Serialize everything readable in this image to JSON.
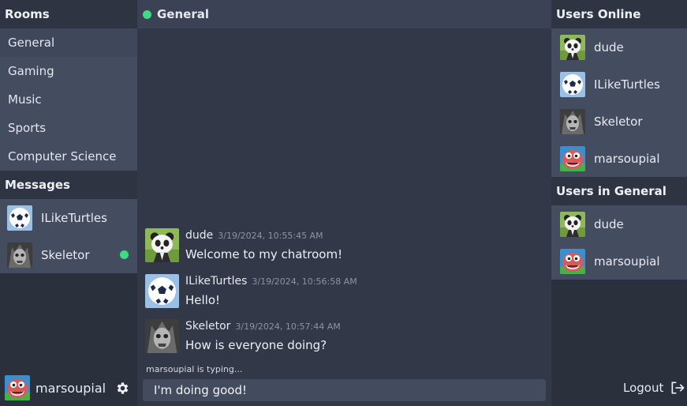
{
  "sidebar": {
    "rooms_heading": "Rooms",
    "rooms": [
      {
        "label": "General"
      },
      {
        "label": "Gaming"
      },
      {
        "label": "Music"
      },
      {
        "label": "Sports"
      },
      {
        "label": "Computer Science"
      }
    ],
    "messages_heading": "Messages",
    "direct_messages": [
      {
        "name": "ILikeTurtles",
        "avatar": "soccer-ball",
        "unread": false
      },
      {
        "name": "Skeletor",
        "avatar": "skeletor",
        "unread": true
      }
    ],
    "current_user": {
      "name": "marsoupial",
      "avatar": "marsoupial"
    },
    "settings_icon": "gear-icon"
  },
  "channel": {
    "name": "General",
    "status_color": "#3ddc84",
    "messages": [
      {
        "author": "dude",
        "timestamp": "3/19/2024, 10:55:45 AM",
        "text": "Welcome to my chatroom!",
        "avatar": "panda"
      },
      {
        "author": "ILikeTurtles",
        "timestamp": "3/19/2024, 10:56:58 AM",
        "text": "Hello!",
        "avatar": "soccer-ball"
      },
      {
        "author": "Skeletor",
        "timestamp": "3/19/2024, 10:57:44 AM",
        "text": "How is everyone doing?",
        "avatar": "skeletor"
      }
    ],
    "typing_indicator": "marsoupial is typing...",
    "composer_value": "I'm doing good!"
  },
  "right_panel": {
    "online_heading": "Users Online",
    "online_users": [
      {
        "name": "dude",
        "avatar": "panda"
      },
      {
        "name": "ILikeTurtles",
        "avatar": "soccer-ball"
      },
      {
        "name": "Skeletor",
        "avatar": "skeletor"
      },
      {
        "name": "marsoupial",
        "avatar": "marsoupial"
      }
    ],
    "room_heading": "Users in General",
    "room_users": [
      {
        "name": "dude",
        "avatar": "panda"
      },
      {
        "name": "marsoupial",
        "avatar": "marsoupial"
      }
    ],
    "logout_label": "Logout",
    "logout_icon": "logout-icon"
  }
}
